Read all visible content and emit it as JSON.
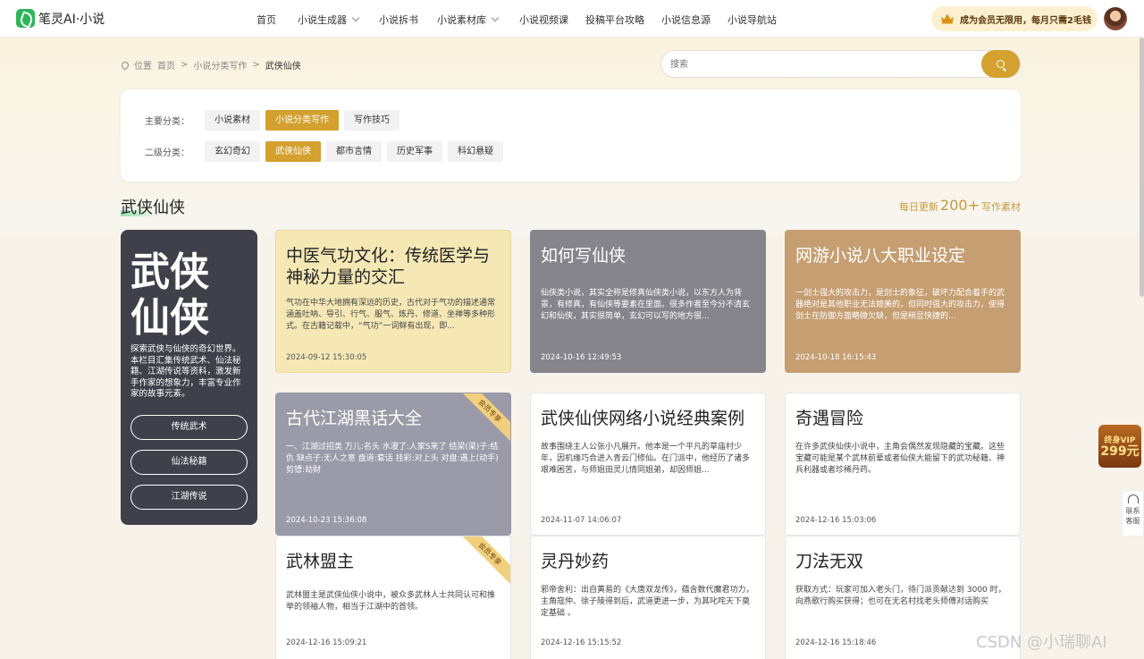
{
  "app": {
    "logo_text": "笔灵AI·小说"
  },
  "nav": [
    {
      "label": "首页"
    },
    {
      "label": "小说生成器"
    },
    {
      "label": "小说拆书"
    },
    {
      "label": "小说素材库"
    },
    {
      "label": "小说视频课"
    },
    {
      "label": "投稿平台攻略"
    },
    {
      "label": "小说信息源"
    },
    {
      "label": "小说导航站"
    }
  ],
  "vip_banner": "成为会员无限用，每月只需2毛钱",
  "breadcrumb": {
    "root": "位置",
    "items": [
      "首页",
      "小说分类写作",
      "武侠仙侠"
    ],
    "sep": ">"
  },
  "search": {
    "placeholder": "搜索"
  },
  "filter": {
    "primary_label": "主要分类：",
    "primary": [
      "小说素材",
      "小说分类写作",
      "写作技巧"
    ],
    "secondary_label": "二级分类：",
    "secondary": [
      "玄幻奇幻",
      "武侠仙侠",
      "都市言情",
      "历史军事",
      "科幻悬疑"
    ]
  },
  "section": {
    "title": "武侠仙侠",
    "update_prefix": "每日更新",
    "update_count": "200+",
    "update_suffix": "写作素材"
  },
  "side": {
    "title": "武侠仙侠",
    "desc": "探索武侠与仙侠的奇幻世界。本栏目汇集传统武术、仙法秘籍、江湖传说等资料，激发新手作家的想象力，丰富专业作家的故事元素。",
    "buttons": [
      "传统武术",
      "仙法秘籍",
      "江湖传说"
    ]
  },
  "cards": [
    {
      "title": "中医气功文化：传统医学与神秘力量的交汇",
      "desc": "气功在中华大地拥有深远的历史，古代对于气功的描述通常涵盖吐呐、导引、行气、服气、炼丹、修道、坐禅等多种形式。在古籍记载中，“气功”一词鲜有出现，即...",
      "date": "2024-09-12 15:30:05",
      "badge": ""
    },
    {
      "title": "如何写仙侠",
      "desc": "仙侠类小说，其实全称是修真仙侠类小说，以东方人为背景，有修真，有仙侠等要素在里面。很多作者至今分不清玄幻和仙侠，其实很简单，玄幻可以写的地方很...",
      "date": "2024-10-16 12:49:53",
      "badge": ""
    },
    {
      "title": "网游小说八大职业设定",
      "desc": "一剑士强大的攻击力，是剑士的象征，破坏力配合着手的武器绝对是其他职业无法媲美的，但同时强大的攻击力，使得剑士在防御方面略微欠缺，但是稍显快捷的...",
      "date": "2024-10-18 16:15:43",
      "badge": ""
    },
    {
      "title": "古代江湖黑话大全",
      "desc": "一、江湖过招类 万儿:名头 水漫了:人家S来了 结梁(梁)子:结仇 缺点子:无人之意 盘道:套话 挂彩:对上头 对盘:遇上(动手) 剪镖:劫财",
      "date": "2024-10-23 15:36:08",
      "badge": "会员专享"
    },
    {
      "title": "武侠仙侠网络小说经典案例",
      "desc": "故事围绕主人公张小凡展开。他本是一个平凡的草庙村少年，因机缘巧合进入青云门修仙。在门派中，他经历了诸多艰难困苦，与师姐田灵儿情同姐弟，却因师姐...",
      "date": "2024-11-07 14:06:07",
      "badge": ""
    },
    {
      "title": "奇遇冒险",
      "desc": "在许多武侠仙侠小说中，主角会偶然发现隐藏的宝藏。这些宝藏可能是某个武林前辈或者仙侠大能留下的武功秘籍、神兵利器或者珍稀丹药。",
      "date": "2024-12-16 15:03:06",
      "badge": ""
    },
    {
      "title": "武林盟主",
      "desc": "武林盟主是武侠仙侠小说中，被众多武林人士共同认可和推举的领袖人物，相当于江湖中的首领。",
      "date": "2024-12-16 15:09:21",
      "badge": "会员专享"
    },
    {
      "title": "灵丹妙药",
      "desc": "邪帝舍利：出自黄易的《大唐双龙传》，蕴含数代魔君功力，主角寇仲、徐子陵得到后，武道更进一步，为其叱咤天下奠定基础 。",
      "date": "2024-12-16 15:15:52",
      "badge": ""
    },
    {
      "title": "刀法无双",
      "desc": "获取方式：玩家可加入老头门，待门派贡献达到 3000 时，向燕歌行购买获得；也可在无名村找老头师傅对话购买",
      "date": "2024-12-16 15:18:46",
      "badge": ""
    }
  ],
  "float": {
    "vip_line1": "终身VIP",
    "vip_line2": "299元",
    "service": "联系客服"
  },
  "watermark": "CSDN @小瑞聊AI",
  "colors": {
    "accent": "#d4a02e",
    "brand_green": "#2db65a"
  }
}
